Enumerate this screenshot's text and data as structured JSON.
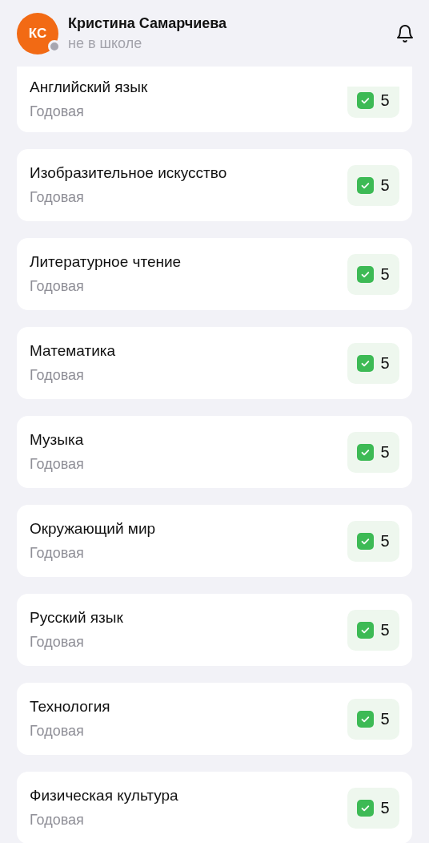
{
  "user": {
    "initials": "КС",
    "name": "Кристина Самарчиева",
    "status": "не в школе",
    "online": false
  },
  "subjects": [
    {
      "name": "Английский язык",
      "period": "Годовая",
      "grade": "5",
      "checked": true
    },
    {
      "name": "Изобразительное искусство",
      "period": "Годовая",
      "grade": "5",
      "checked": true
    },
    {
      "name": "Литературное чтение",
      "period": "Годовая",
      "grade": "5",
      "checked": true
    },
    {
      "name": "Математика",
      "period": "Годовая",
      "grade": "5",
      "checked": true
    },
    {
      "name": "Музыка",
      "period": "Годовая",
      "grade": "5",
      "checked": true
    },
    {
      "name": "Окружающий мир",
      "period": "Годовая",
      "grade": "5",
      "checked": true
    },
    {
      "name": "Русский язык",
      "period": "Годовая",
      "grade": "5",
      "checked": true
    },
    {
      "name": "Технология",
      "period": "Годовая",
      "grade": "5",
      "checked": true
    },
    {
      "name": "Физическая культура",
      "period": "Годовая",
      "grade": "5",
      "checked": true
    }
  ]
}
